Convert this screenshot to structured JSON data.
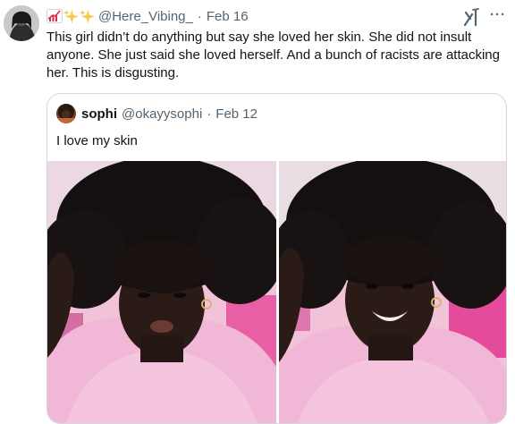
{
  "tweet": {
    "handle": "@Here_Vibing_",
    "separator": "·",
    "date": "Feb 16",
    "name_emojis": [
      "chart-increasing-icon",
      "sparkles-icon",
      "sparkles-icon"
    ],
    "text": "This girl didn’t do anything but say she loved her skin. She did not insult anyone. She just said she loved herself. And a bunch of racists are attacking her. This is disgusting.",
    "more_label": "···"
  },
  "quote": {
    "name": "sophi",
    "handle": "@okayysophi",
    "separator": "·",
    "date": "Feb 12",
    "text": "I love my skin",
    "photos": [
      "selfie-photo-pouting",
      "selfie-photo-smiling"
    ]
  },
  "colors": {
    "text_primary": "#0f1419",
    "text_secondary": "#536471",
    "border": "#cfd9de",
    "sparkle": "#f7c948"
  }
}
